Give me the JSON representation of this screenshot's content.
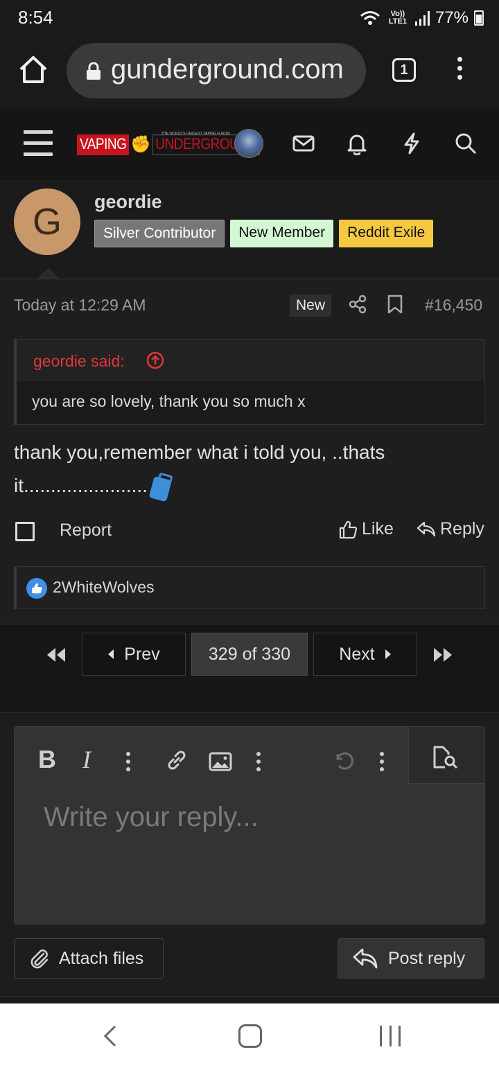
{
  "status_bar": {
    "time": "8:54",
    "network": "Vo)) LTE1",
    "battery": "77%"
  },
  "browser": {
    "url": "gunderground.com",
    "tab_count": "1"
  },
  "site_header": {
    "logo_left": "VAPING",
    "logo_right": "UNDERGROUND",
    "logo_tagline": "THE WORLD'S LARGEST VAPING FORUM"
  },
  "post": {
    "author": {
      "initial": "G",
      "username": "geordie",
      "badges": [
        "Silver Contributor",
        "New Member",
        "Reddit Exile"
      ]
    },
    "timestamp": "Today at 12:29 AM",
    "new_label": "New",
    "post_number": "#16,450",
    "quote": {
      "author_line": "geordie said:",
      "text": "you are so lovely, thank you so much x"
    },
    "message": "thank you,remember what i told you, ..thats it.......................",
    "actions": {
      "report": "Report",
      "like": "Like",
      "reply": "Reply"
    },
    "reactions": {
      "users": "2WhiteWolves"
    }
  },
  "pagination": {
    "prev": "Prev",
    "current": "329 of 330",
    "next": "Next"
  },
  "editor": {
    "placeholder": "Write your reply...",
    "attach": "Attach files",
    "post_reply": "Post reply"
  },
  "colors": {
    "accent_red": "#e0373a",
    "like_blue": "#3f8ee8",
    "badge_new_member": "#d3f7d3",
    "badge_reddit": "#f5c842"
  }
}
